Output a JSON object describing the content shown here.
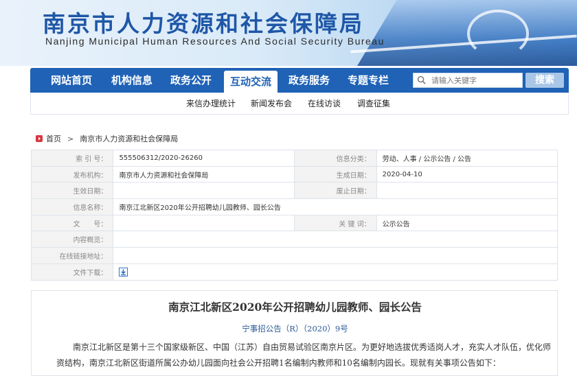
{
  "header": {
    "title": "南京市人力资源和社会保障局",
    "subtitle": "Nanjing Municipal Human Resources And Social Security Bureau"
  },
  "nav": {
    "items": [
      {
        "label": "网站首页",
        "active": false
      },
      {
        "label": "机构信息",
        "active": false
      },
      {
        "label": "政务公开",
        "active": false
      },
      {
        "label": "互动交流",
        "active": true
      },
      {
        "label": "政务服务",
        "active": false
      },
      {
        "label": "专题专栏",
        "active": false
      }
    ],
    "search_placeholder": "请输入关键字",
    "search_button": "搜索"
  },
  "subnav": {
    "items": [
      "来信办理统计",
      "新闻发布会",
      "在线访谈",
      "调查征集"
    ]
  },
  "breadcrumb": {
    "home": "首页",
    "current": "南京市人力资源和社会保障局"
  },
  "meta": {
    "index_label": "索 引 号：",
    "index_value": "555506312/2020-26260",
    "category_label": "信息分类：",
    "category_value": "劳动、人事 / 公示公告 / 公告",
    "publisher_label": "发布机构：",
    "publisher_value": "南京市人力资源和社会保障局",
    "created_label": "生成日期：",
    "created_value": "2020-04-10",
    "effective_label": "生效日期：",
    "effective_value": "",
    "abolished_label": "废止日期：",
    "abolished_value": "",
    "name_label": "信息名称：",
    "name_value": "南京江北新区2020年公开招聘幼儿园教师、园长公告",
    "docno_label": "文　　号：",
    "docno_value": "",
    "keywords_label": "关 键 词：",
    "keywords_value": "公示公告",
    "summary_label": "内容概览：",
    "summary_value": "",
    "online_label": "在线链接地址：",
    "online_value": "",
    "download_label": "文件下载："
  },
  "article": {
    "title": "南京江北新区2020年公开招聘幼儿园教师、园长公告",
    "doc_number": "宁事招公告（R）（2020）9号",
    "paragraph": "南京江北新区是第十三个国家级新区、中国（江苏）自由贸易试验区南京片区。为更好地选拔优秀适岗人才，充实人才队伍，优化师资结构，南京江北新区街道所属公办幼儿园面向社会公开招聘1名编制内教师和10名编制内园长。现就有关事项公告如下："
  },
  "colors": {
    "nav_blue": "#1f62b6",
    "title_blue": "#1f57a7",
    "home_red": "#d9363e"
  }
}
